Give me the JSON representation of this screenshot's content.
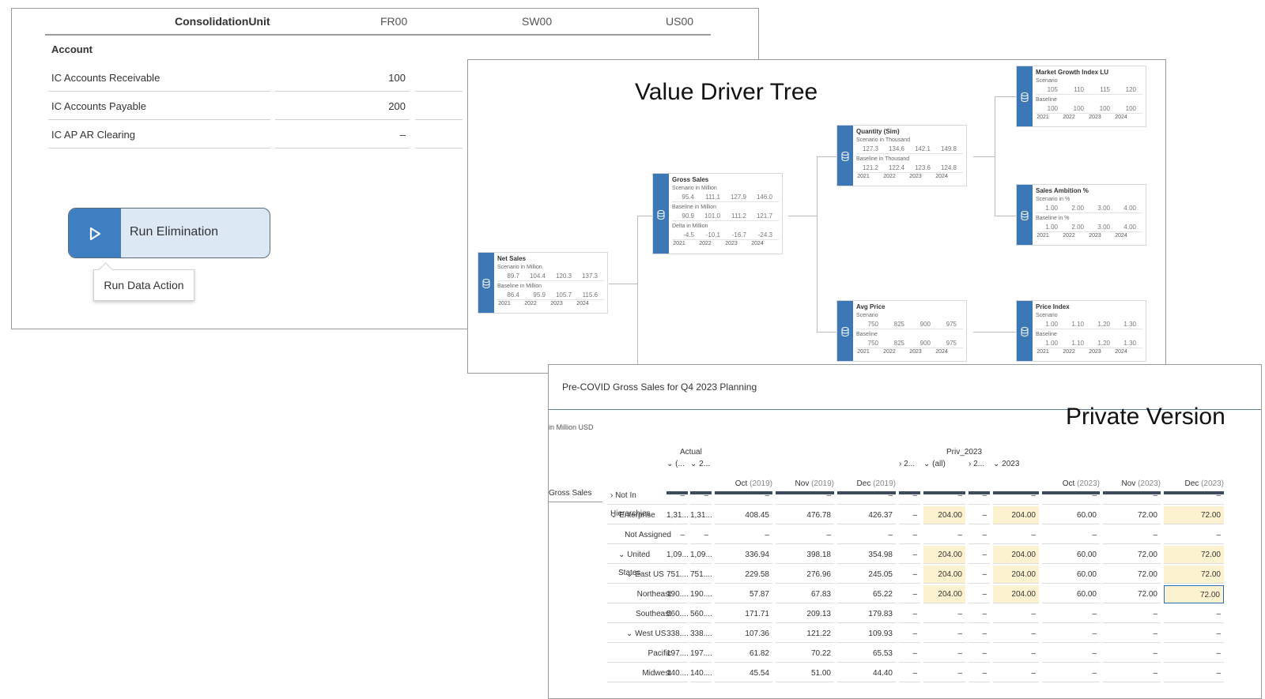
{
  "consolidation": {
    "header_unit": "ConsolidationUnit",
    "columns": [
      "FR00",
      "SW00",
      "US00"
    ],
    "account_label": "Account",
    "rows": [
      {
        "label": "IC Accounts Receivable",
        "value": "100"
      },
      {
        "label": "IC Accounts Payable",
        "value": "200"
      },
      {
        "label": "IC AP AR Clearing",
        "value": "–"
      }
    ],
    "run_button_label": "Run Elimination",
    "tooltip": "Run Data Action"
  },
  "vdt": {
    "title": "Value Driver Tree",
    "nodes": {
      "net_sales": {
        "title": "Net Sales",
        "groups": [
          {
            "label": "Scenario in Million",
            "values": [
              "89.7",
              "104.4",
              "120.3",
              "137.3"
            ]
          },
          {
            "label": "Baseline in Million",
            "values": [
              "86.4",
              "95.9",
              "105.7",
              "115.6"
            ]
          }
        ],
        "years": [
          "2021",
          "2022",
          "2023",
          "2024"
        ]
      },
      "gross_sales": {
        "title": "Gross Sales",
        "groups": [
          {
            "label": "Scenario in Million",
            "values": [
              "95.4",
              "111.1",
              "127.9",
              "146.0"
            ]
          },
          {
            "label": "Baseline in Million",
            "values": [
              "90.9",
              "101.0",
              "111.2",
              "121.7"
            ]
          },
          {
            "label": "Delta in Million",
            "values": [
              "-4.5",
              "-10.1",
              "-16.7",
              "-24.3"
            ]
          }
        ],
        "years": [
          "2021",
          "2022",
          "2023",
          "2024"
        ]
      },
      "quantity": {
        "title": "Quantity (Sim)",
        "groups": [
          {
            "label": "Scenario in Thousand",
            "values": [
              "127.3",
              "134.6",
              "142.1",
              "149.8"
            ]
          },
          {
            "label": "Baseline in Thousand",
            "values": [
              "121.2",
              "122.4",
              "123.6",
              "124.8"
            ]
          }
        ],
        "years": [
          "2021",
          "2022",
          "2023",
          "2024"
        ]
      },
      "avg_price": {
        "title": "Avg Price",
        "groups": [
          {
            "label": "Scenario",
            "values": [
              "750",
              "825",
              "900",
              "975"
            ]
          },
          {
            "label": "Baseline",
            "values": [
              "750",
              "825",
              "900",
              "975"
            ]
          }
        ],
        "years": [
          "2021",
          "2022",
          "2023",
          "2024"
        ]
      },
      "market_growth": {
        "title": "Market Growth Index LU",
        "groups": [
          {
            "label": "Scenario",
            "values": [
              "105",
              "110",
              "115",
              "120"
            ]
          },
          {
            "label": "Baseline",
            "values": [
              "100",
              "100",
              "100",
              "100"
            ]
          }
        ],
        "years": [
          "2021",
          "2022",
          "2023",
          "2024"
        ]
      },
      "sales_ambition": {
        "title": "Sales Ambition %",
        "groups": [
          {
            "label": "Scenario in %",
            "values": [
              "1.00",
              "2.00",
              "3.00",
              "4.00"
            ]
          },
          {
            "label": "Baseline in %",
            "values": [
              "1.00",
              "2.00",
              "3.00",
              "4.00"
            ]
          }
        ],
        "years": [
          "2021",
          "2022",
          "2023",
          "2024"
        ]
      },
      "price_index": {
        "title": "Price Index",
        "groups": [
          {
            "label": "Scenario",
            "values": [
              "1.00",
              "1.10",
              "1.20",
              "1.30"
            ]
          },
          {
            "label": "Baseline",
            "values": [
              "1.00",
              "1.10",
              "1.20",
              "1.30"
            ]
          }
        ],
        "years": [
          "2021",
          "2022",
          "2023",
          "2024"
        ]
      }
    }
  },
  "grid": {
    "title": "Pre-COVID Gross Sales for Q4 2023 Planning",
    "unit": "in Million USD",
    "overlay_title": "Private Version",
    "version_actual": "Actual",
    "version_priv": "Priv_2023",
    "dimension_label": "Gross Sales",
    "columns": [
      {
        "label": "(...",
        "chev": "⌄"
      },
      {
        "label": "2...",
        "chev": "⌄"
      },
      {
        "label": "Oct",
        "sub": "(2019)"
      },
      {
        "label": "Nov",
        "sub": "(2019)"
      },
      {
        "label": "Dec",
        "sub": "(2019)"
      },
      {
        "label": "2...",
        "chev": "›"
      },
      {
        "label": "(all)",
        "chev": "⌄"
      },
      {
        "label": "2...",
        "chev": "›"
      },
      {
        "label": "2023",
        "chev": "⌄"
      },
      {
        "label": "Oct",
        "sub": "(2023)"
      },
      {
        "label": "Nov",
        "sub": "(2023)"
      },
      {
        "label": "Dec",
        "sub": "(2023)"
      }
    ],
    "rows": [
      {
        "label": "Not In Hierarchies",
        "chev": "›",
        "cells": [
          "–",
          "–",
          "–",
          "–",
          "–",
          "–",
          "–",
          "–",
          "–",
          "–",
          "–",
          "–"
        ]
      },
      {
        "label": "Enterprise",
        "chev": "⌄",
        "cells": [
          "1,31...",
          "1,31...",
          "408.45",
          "476.78",
          "426.37",
          "–",
          "204.00",
          "–",
          "204.00",
          "60.00",
          "72.00",
          "72.00"
        ]
      },
      {
        "label": "Not Assigned",
        "chev": "",
        "cells": [
          "–",
          "–",
          "–",
          "–",
          "–",
          "–",
          "–",
          "–",
          "–",
          "–",
          "–",
          "–"
        ]
      },
      {
        "label": "United States",
        "chev": "⌄",
        "cells": [
          "1,09...",
          "1,09...",
          "336.94",
          "398.18",
          "354.98",
          "–",
          "204.00",
          "–",
          "204.00",
          "60.00",
          "72.00",
          "72.00"
        ]
      },
      {
        "label": "East US",
        "chev": "⌄",
        "cells": [
          "751....",
          "751....",
          "229.58",
          "276.96",
          "245.05",
          "–",
          "204.00",
          "–",
          "204.00",
          "60.00",
          "72.00",
          "72.00"
        ]
      },
      {
        "label": "Northeast",
        "chev": "",
        "cells": [
          "190....",
          "190....",
          "57.87",
          "67.83",
          "65.22",
          "–",
          "204.00",
          "–",
          "204.00",
          "60.00",
          "72.00",
          "72.00"
        ]
      },
      {
        "label": "Southeast",
        "chev": "",
        "cells": [
          "560....",
          "560....",
          "171.71",
          "209.13",
          "179.83",
          "–",
          "–",
          "–",
          "–",
          "–",
          "–",
          "–"
        ]
      },
      {
        "label": "West US",
        "chev": "⌄",
        "cells": [
          "338....",
          "338....",
          "107.36",
          "121.22",
          "109.93",
          "–",
          "–",
          "–",
          "–",
          "–",
          "–",
          "–"
        ]
      },
      {
        "label": "Pacific",
        "chev": "",
        "cells": [
          "197....",
          "197....",
          "61.82",
          "70.22",
          "65.53",
          "–",
          "–",
          "–",
          "–",
          "–",
          "–",
          "–"
        ]
      },
      {
        "label": "Midwest",
        "chev": "",
        "cells": [
          "140....",
          "140....",
          "45.54",
          "51.00",
          "44.40",
          "–",
          "–",
          "–",
          "–",
          "–",
          "–",
          "–"
        ]
      }
    ],
    "highlight_color": "#fdf2d0"
  }
}
